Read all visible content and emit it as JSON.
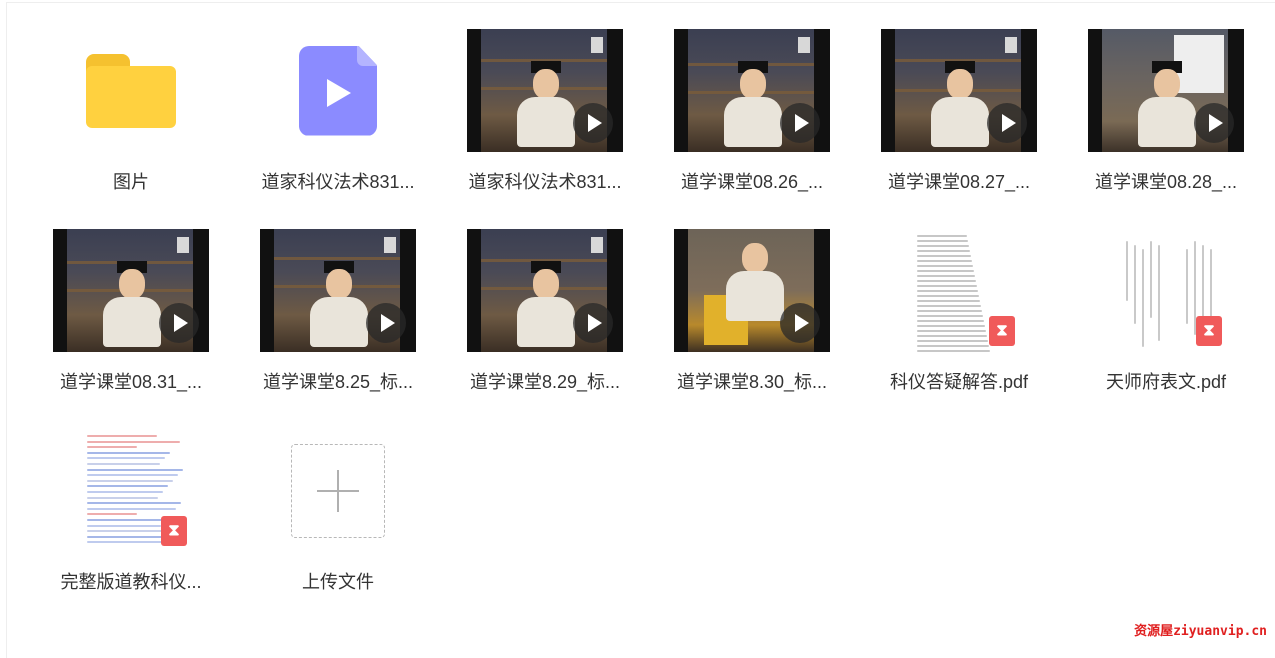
{
  "files": [
    {
      "name": "图片",
      "type": "folder",
      "icon": "folder-icon"
    },
    {
      "name": "道家科仪法术831...",
      "type": "video-file",
      "icon": "video-file-icon"
    },
    {
      "name": "道家科仪法术831...",
      "type": "video"
    },
    {
      "name": "道学课堂08.26_...",
      "type": "video"
    },
    {
      "name": "道学课堂08.27_...",
      "type": "video"
    },
    {
      "name": "道学课堂08.28_...",
      "type": "video"
    },
    {
      "name": "道学课堂08.31_...",
      "type": "video"
    },
    {
      "name": "道学课堂8.25_标...",
      "type": "video"
    },
    {
      "name": "道学课堂8.29_标...",
      "type": "video"
    },
    {
      "name": "道学课堂8.30_标...",
      "type": "video"
    },
    {
      "name": "科仪答疑解答.pdf",
      "type": "pdf"
    },
    {
      "name": "天师府表文.pdf",
      "type": "pdf"
    },
    {
      "name": "完整版道教科仪...",
      "type": "pdf"
    }
  ],
  "upload": {
    "label": "上传文件",
    "icon": "plus-icon"
  },
  "watermark": "资源屋ziyuanvip.cn",
  "colors": {
    "folder": "#ffd13f",
    "video_icon": "#8b8bff",
    "pdf_badge": "#f05a5a",
    "watermark": "#e02020"
  }
}
